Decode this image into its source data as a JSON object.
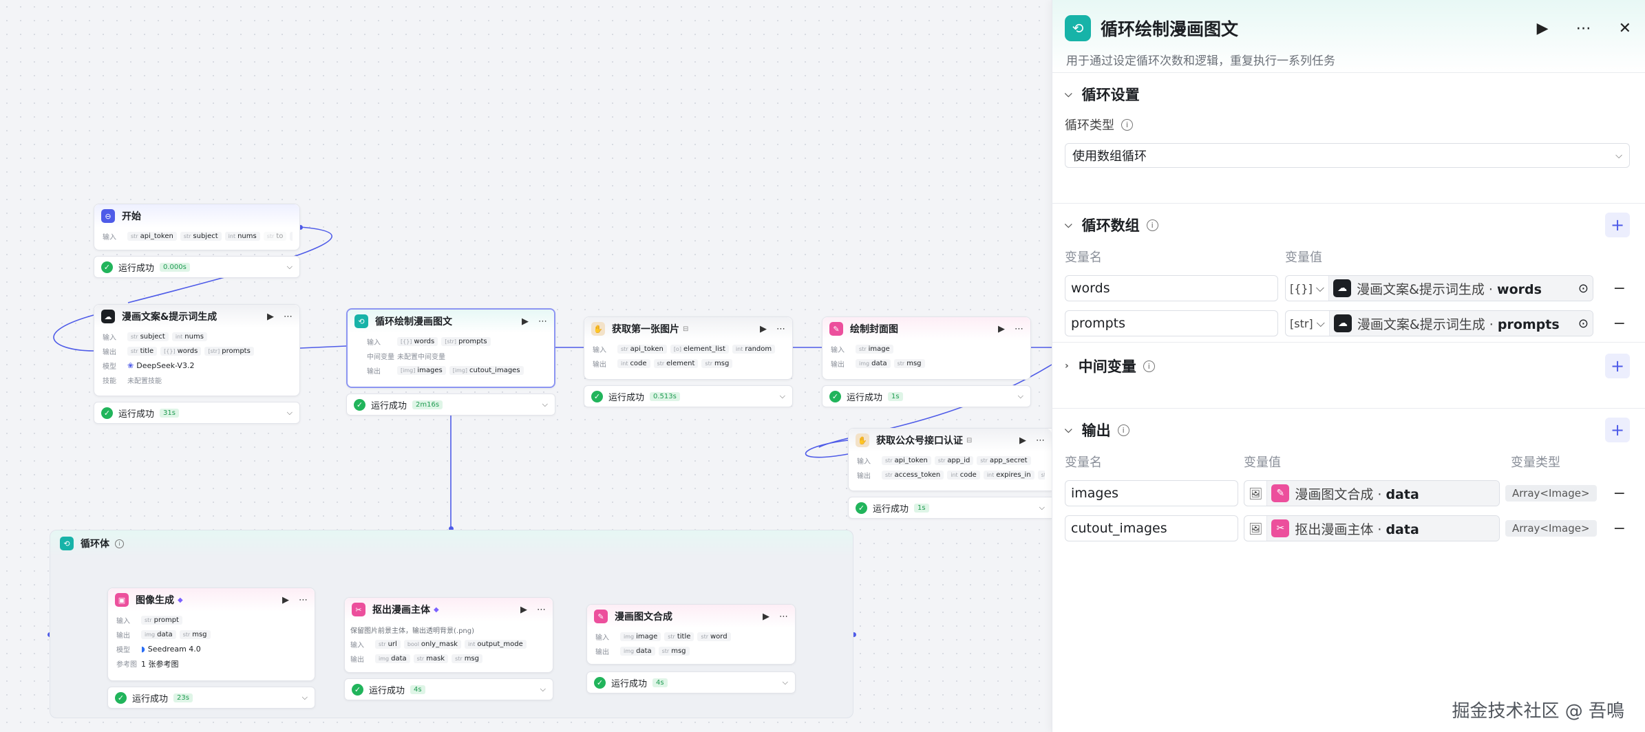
{
  "canvas": {
    "start": {
      "title": "开始",
      "lbl_in": "输入",
      "inputs": [
        "api_token",
        "subject",
        "nums",
        "to"
      ],
      "more": "···",
      "status": "运行成功",
      "time": "0.000s"
    },
    "copy": {
      "title": "漫画文案&提示词生成",
      "lbl_in": "输入",
      "lbl_out": "输出",
      "lbl_model": "模型",
      "lbl_skill": "技能",
      "inputs": [
        "subject",
        "nums"
      ],
      "outputs": [
        "title",
        "words",
        "prompts"
      ],
      "model": "DeepSeek-V3.2",
      "skill": "未配置技能",
      "status": "运行成功",
      "time": "31s"
    },
    "loop": {
      "title": "循环绘制漫画图文",
      "lbl_in": "输入",
      "lbl_mid": "中间变量",
      "lbl_out": "输出",
      "inputs": [
        "words",
        "prompts"
      ],
      "mid": "未配置中间变量",
      "outputs": [
        "images",
        "cutout_images"
      ],
      "status": "运行成功",
      "time": "2m16s"
    },
    "getimg": {
      "title": "获取第一张图片",
      "lbl_in": "输入",
      "lbl_out": "输出",
      "inputs": [
        "api_token",
        "element_list",
        "random"
      ],
      "outputs": [
        "code",
        "element",
        "msg"
      ],
      "status": "运行成功",
      "time": "0.513s"
    },
    "cover": {
      "title": "绘制封面图",
      "lbl_in": "输入",
      "lbl_out": "输出",
      "inputs": [
        "image"
      ],
      "outputs": [
        "data",
        "msg"
      ],
      "status": "运行成功",
      "time": "1s"
    },
    "auth": {
      "title": "获取公众号接口认证",
      "lbl_in": "输入",
      "lbl_out": "输出",
      "inputs": [
        "api_token",
        "app_id",
        "app_secret"
      ],
      "outputs": [
        "access_token",
        "code",
        "expires_in",
        "msg"
      ],
      "status": "运行成功",
      "time": "1s"
    },
    "loopbody": {
      "title": "循环体"
    },
    "imggen": {
      "title": "图像生成",
      "lbl_in": "输入",
      "lbl_out": "输出",
      "lbl_model": "模型",
      "lbl_ref": "参考图",
      "inputs": [
        "prompt"
      ],
      "outputs": [
        "data",
        "msg"
      ],
      "model": "Seedream 4.0",
      "ref": "1 张参考图",
      "status": "运行成功",
      "time": "23s"
    },
    "cutout": {
      "title": "抠出漫画主体",
      "desc": "保留图片前景主体，输出透明背景(.png)",
      "lbl_in": "输入",
      "lbl_out": "输出",
      "inputs": [
        "url",
        "only_mask",
        "output_mode"
      ],
      "outputs": [
        "data",
        "mask",
        "msg"
      ],
      "status": "运行成功",
      "time": "4s"
    },
    "compose": {
      "title": "漫画图文合成",
      "lbl_in": "输入",
      "lbl_out": "输出",
      "inputs": [
        "image",
        "title",
        "word"
      ],
      "outputs": [
        "data",
        "msg"
      ],
      "status": "运行成功",
      "time": "4s"
    }
  },
  "panel": {
    "title": "循环绘制漫画图文",
    "desc": "用于通过设定循环次数和逻辑，重复执行一系列任务",
    "settings": {
      "title": "循环设置",
      "type_label": "循环类型",
      "type_value": "使用数组循环"
    },
    "array": {
      "title": "循环数组",
      "col_name": "变量名",
      "col_value": "变量值",
      "rows": [
        {
          "name": "words",
          "type": "[{}]",
          "source": "漫画文案&提示词生成",
          "field": "words"
        },
        {
          "name": "prompts",
          "type": "[str]",
          "source": "漫画文案&提示词生成",
          "field": "prompts"
        }
      ]
    },
    "mid": {
      "title": "中间变量"
    },
    "output": {
      "title": "输出",
      "col_name": "变量名",
      "col_value": "变量值",
      "col_type": "变量类型",
      "rows": [
        {
          "name": "images",
          "source": "漫画图文合成",
          "field": "data",
          "type": "Array<Image>"
        },
        {
          "name": "cutout_images",
          "source": "抠出漫画主体",
          "field": "data",
          "type": "Array<Image>"
        }
      ]
    }
  },
  "watermark": "掘金技术社区 @ 吾鳴",
  "colors": {
    "accent": "#4e5be8",
    "teal": "#17b3a8",
    "success": "#21b45b",
    "pink": "#ec4f9c"
  }
}
